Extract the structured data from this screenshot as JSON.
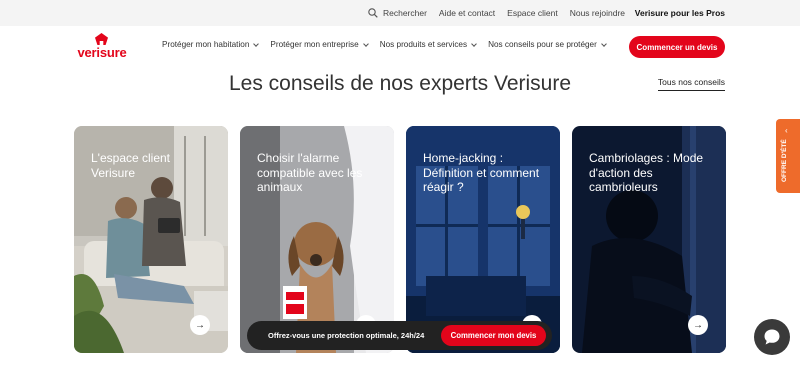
{
  "topbar": {
    "search_label": "Rechercher",
    "links": [
      "Aide et contact",
      "Espace client",
      "Nous rejoindre"
    ],
    "pros_label": "Verisure pour les Pros"
  },
  "brand": {
    "name": "verisure",
    "color": "#e3051b"
  },
  "nav": {
    "items": [
      "Protéger mon habitation",
      "Protéger mon entreprise",
      "Nos produits et services",
      "Nos conseils pour se protéger"
    ],
    "cta_label": "Commencer un devis"
  },
  "main": {
    "headline": "Les conseils de nos experts Verisure",
    "all_link": "Tous nos conseils",
    "cards": [
      {
        "title": "L'espace client Verisure",
        "arrow": "→"
      },
      {
        "title": "Choisir l'alarme compatible avec les animaux",
        "arrow": "→"
      },
      {
        "title": "Home-jacking : Définition et comment réagir ?",
        "arrow": "→"
      },
      {
        "title": "Cambriolages : Mode d'action des cambrioleurs",
        "arrow": "→"
      }
    ]
  },
  "sidetab": {
    "label": "OFFRE D'ÉTÉ",
    "arrow": "‹",
    "color": "#ee6b2b"
  },
  "promo_bar": {
    "text": "Offrez-vous une protection optimale, 24h/24",
    "button_label": "Commencer mon devis"
  },
  "chat": {
    "icon": "chat-bubble-icon"
  }
}
